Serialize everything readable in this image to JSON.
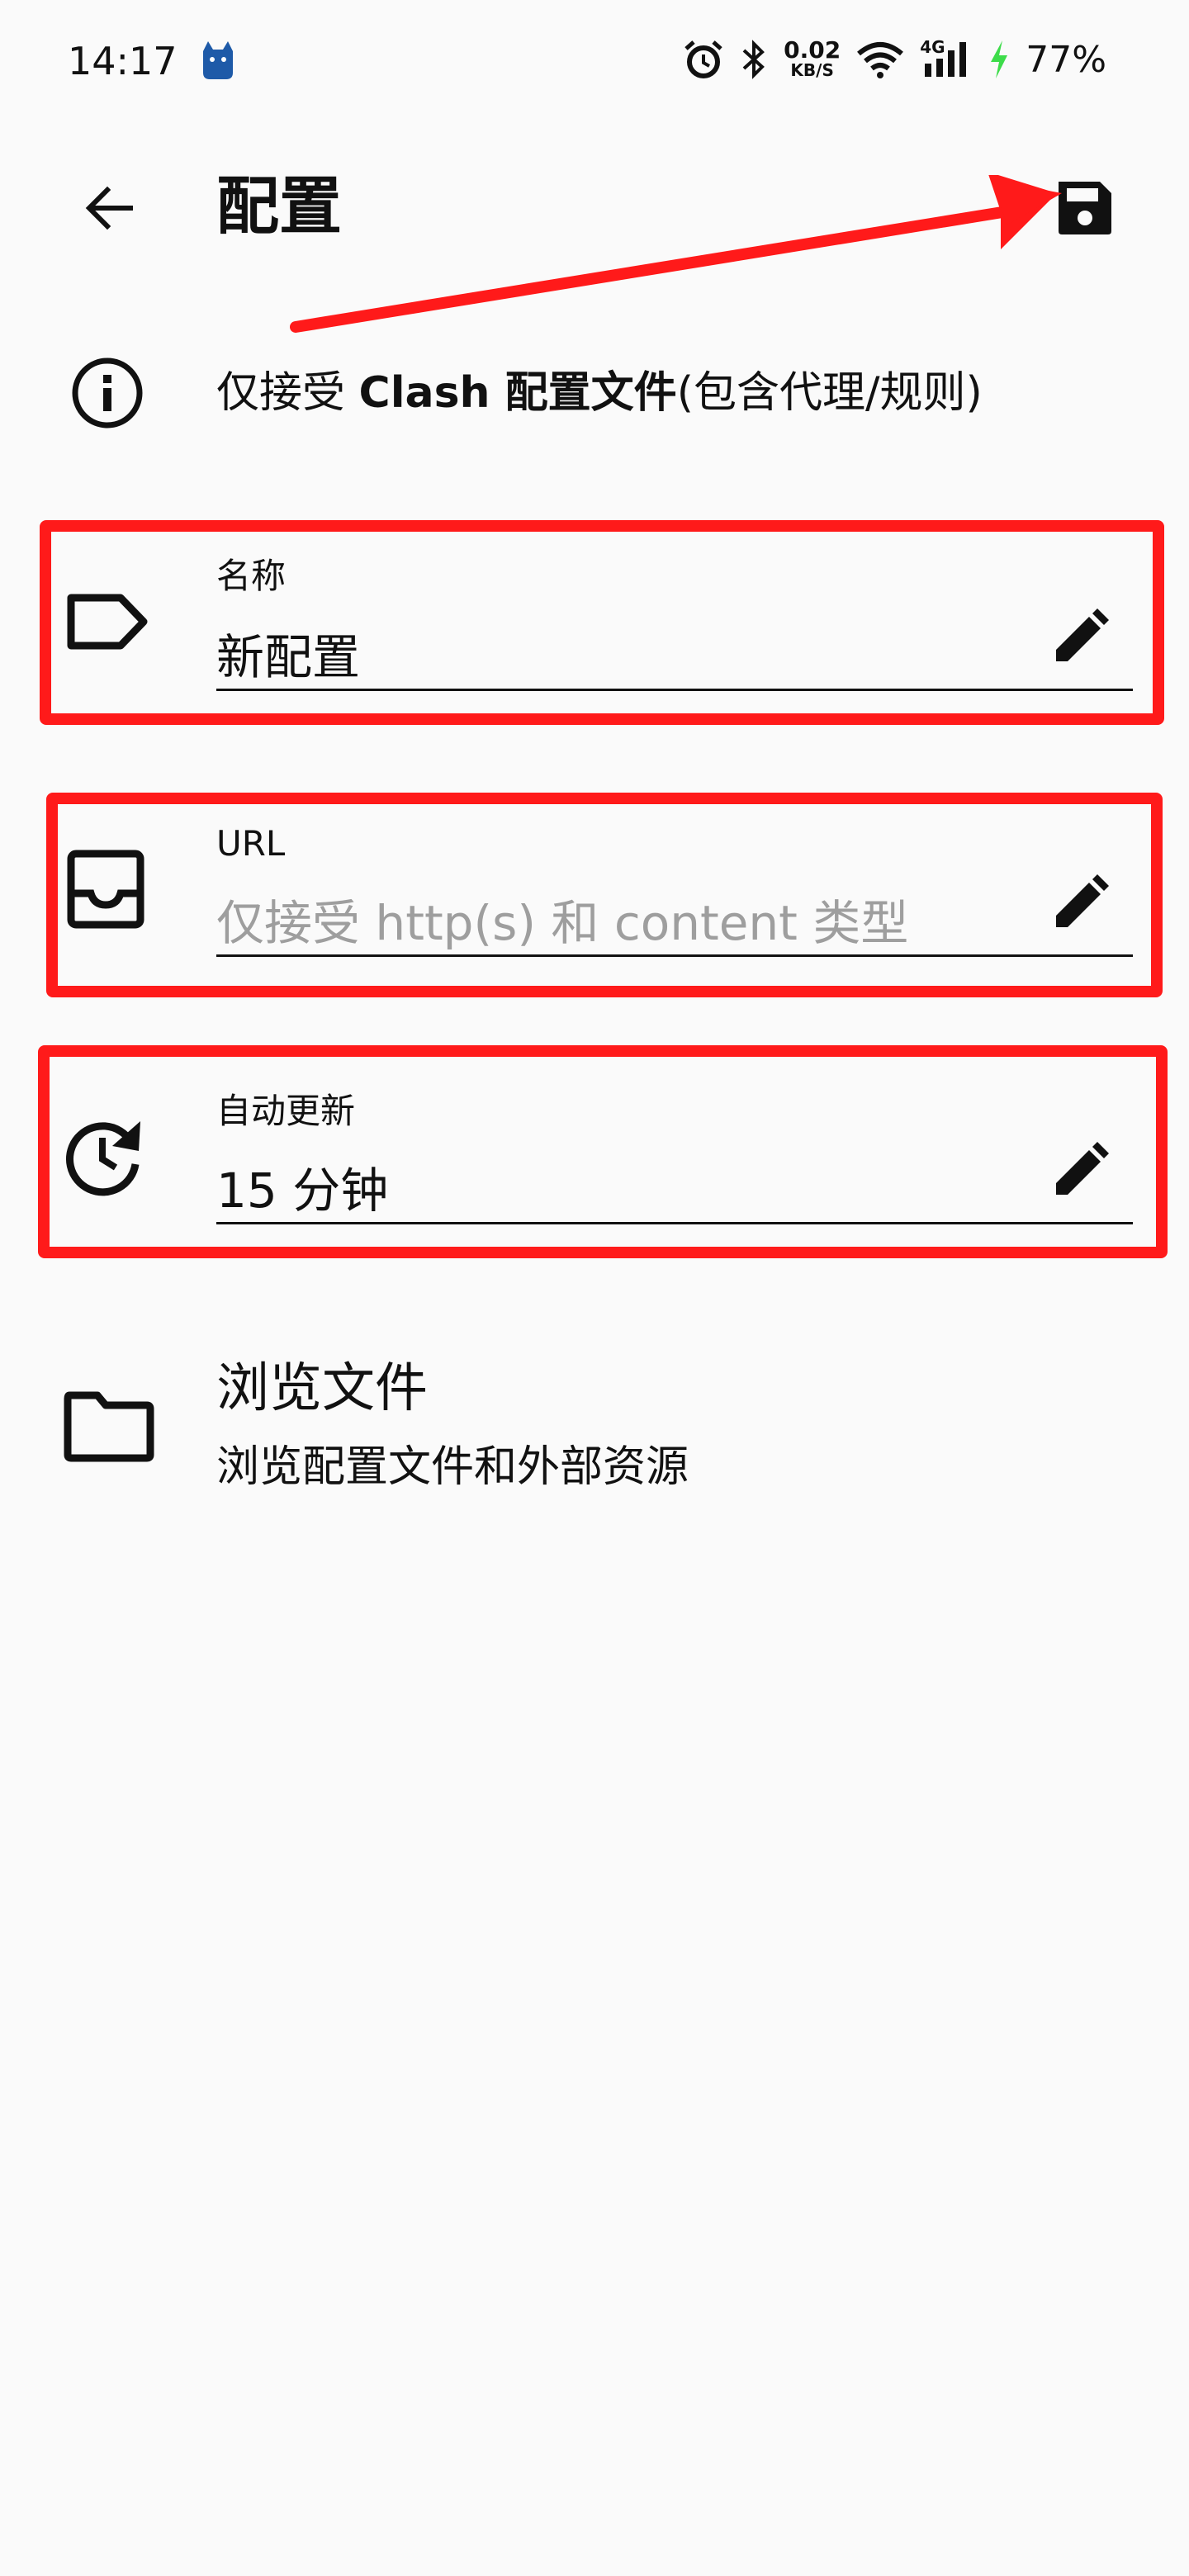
{
  "status_bar": {
    "time": "14:17",
    "net_speed_value": "0.02",
    "net_speed_unit": "KB/S",
    "network_type": "4G",
    "battery": "77%",
    "battery_color": "#3ddc4a"
  },
  "app_bar": {
    "title": "配置"
  },
  "info": {
    "text_before": "仅接受 ",
    "text_bold": "Clash 配置文件",
    "text_after": "(包含代理/规则)"
  },
  "fields": {
    "name": {
      "label": "名称",
      "value": "新配置"
    },
    "url": {
      "label": "URL",
      "placeholder": "仅接受 http(s) 和 content 类型"
    },
    "auto_update": {
      "label": "自动更新",
      "value": "15 分钟"
    }
  },
  "browse": {
    "title": "浏览文件",
    "subtitle": "浏览配置文件和外部资源"
  },
  "colors": {
    "background": "#fafafa",
    "annotation_red": "#ff1a1a",
    "text": "#111111",
    "placeholder": "#9e9e9e"
  },
  "icons": {
    "back": "arrow-left-icon",
    "save": "floppy-disk-icon",
    "info": "info-circle-icon",
    "name": "label-tag-icon",
    "url": "inbox-tray-icon",
    "auto_update": "clock-refresh-icon",
    "edit": "pencil-icon",
    "browse": "folder-icon"
  }
}
